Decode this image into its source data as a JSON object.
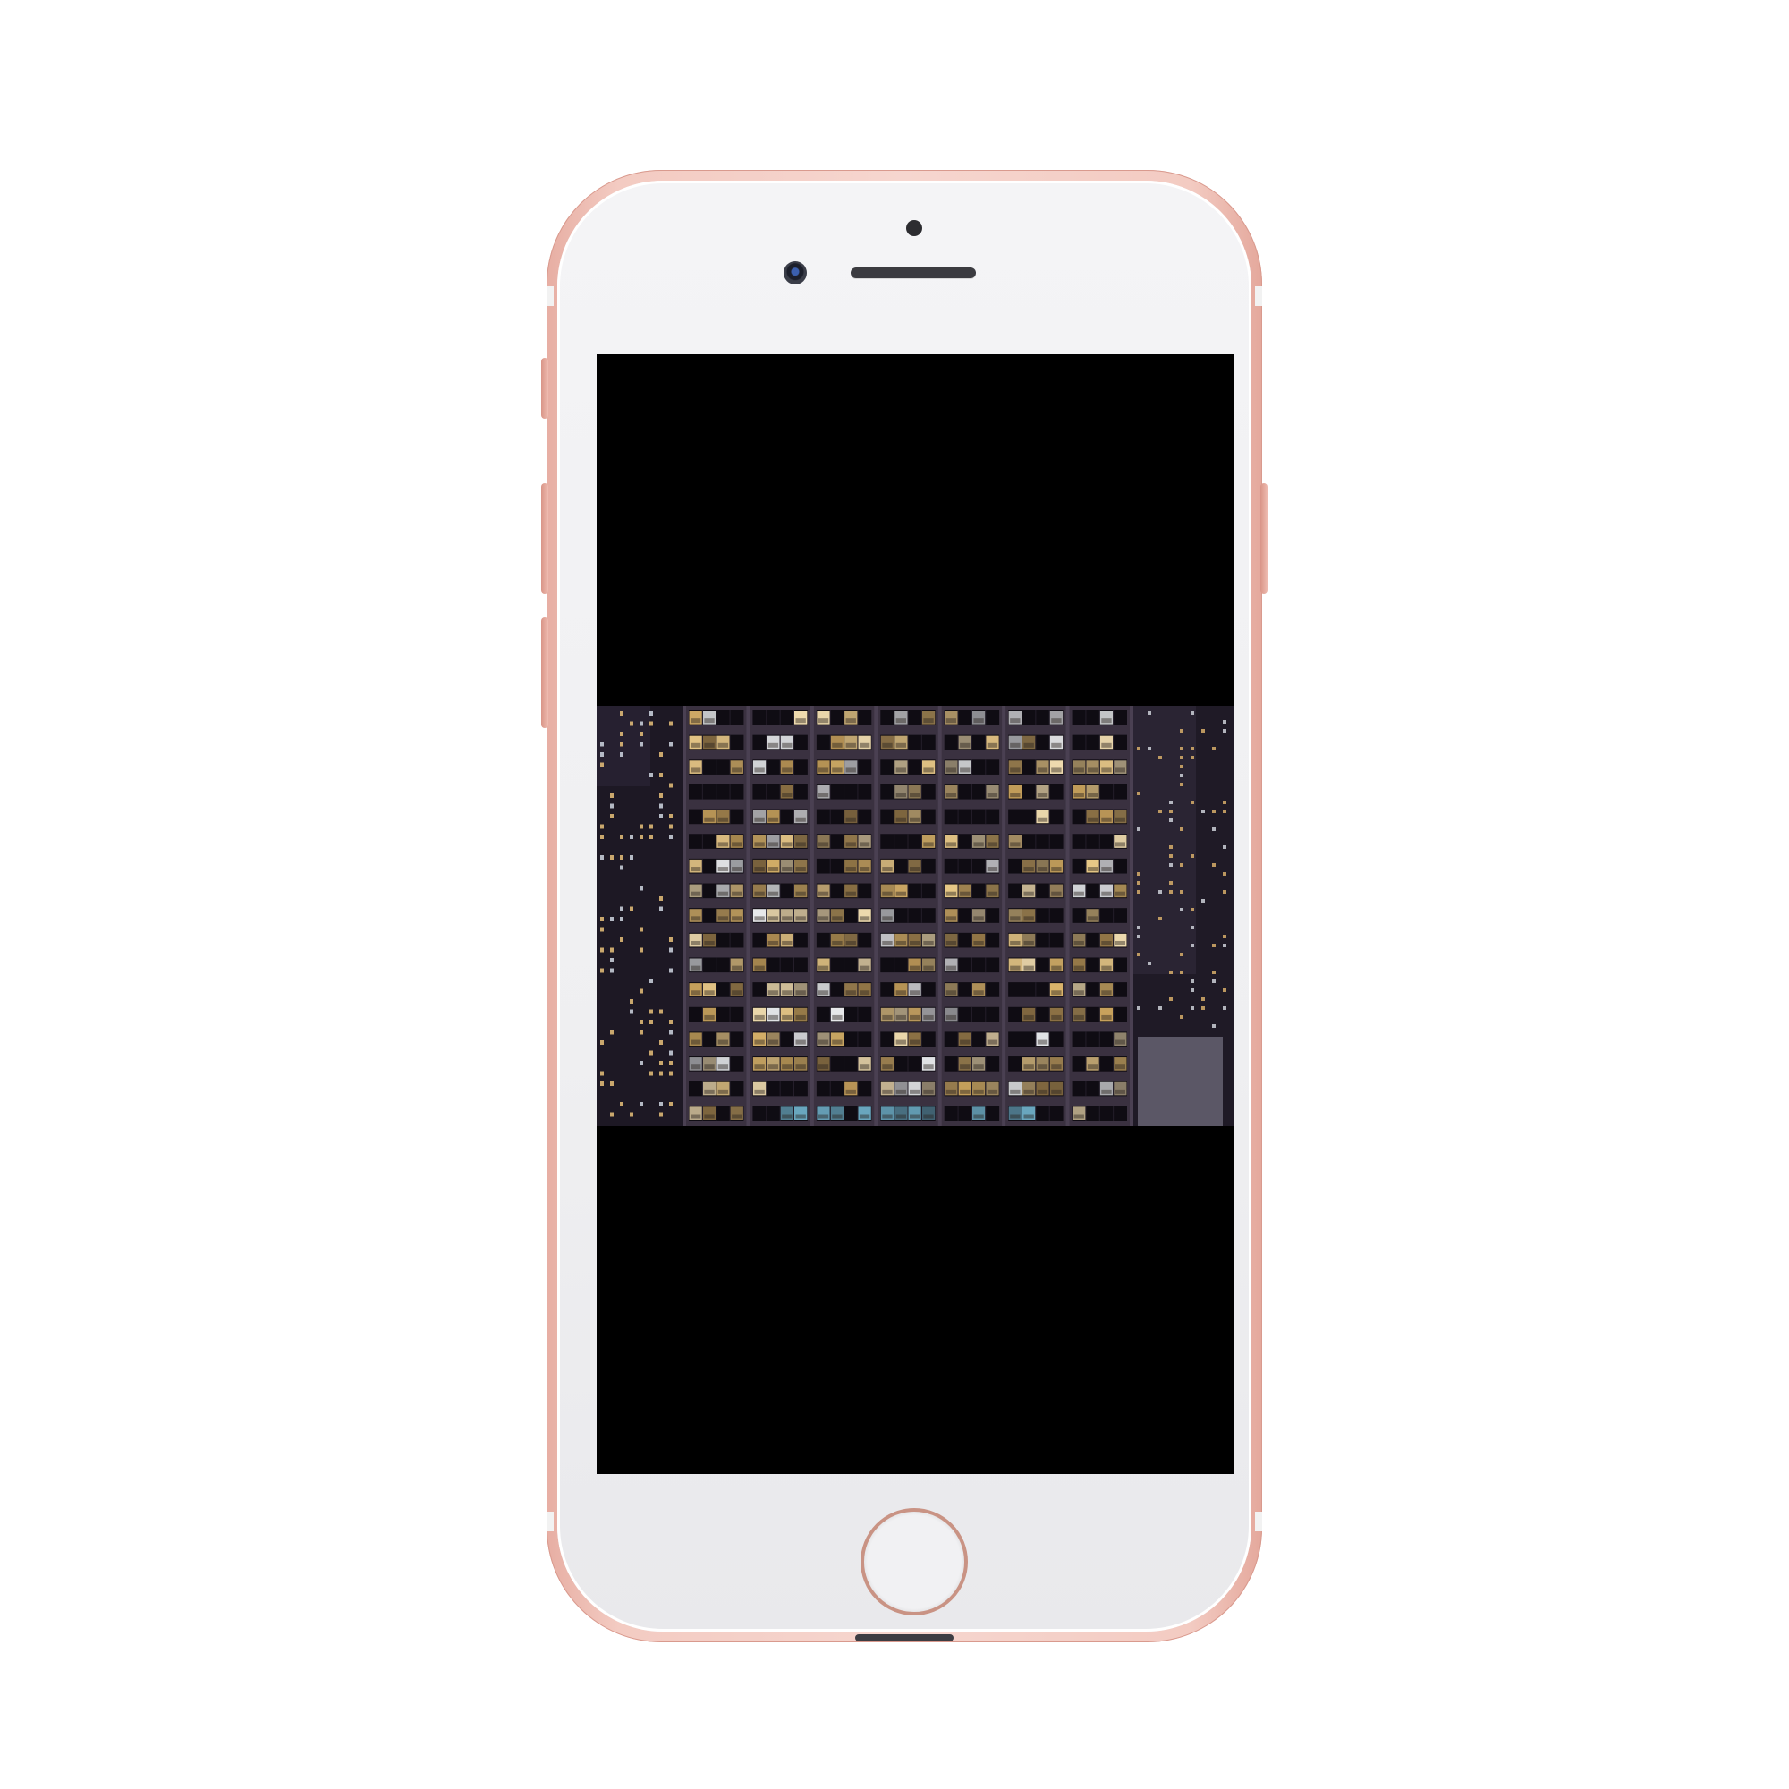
{
  "device": {
    "model": "iPhone",
    "finish": "rose-gold",
    "colors": {
      "frame": "#f3cbc2",
      "face": "#efeff1",
      "screen_background": "#000000",
      "home_ring": "#c99384"
    }
  },
  "screen": {
    "content": "photo-of-office-building-at-night",
    "photo": {
      "floors": 17,
      "columns": 7,
      "facade_color": "#3a3140",
      "window_light_colors": [
        "#e9c988",
        "#d9b36a",
        "#f1ddb0",
        "#c7a15c",
        "#eef0f2",
        "#6aa8c0"
      ]
    }
  }
}
